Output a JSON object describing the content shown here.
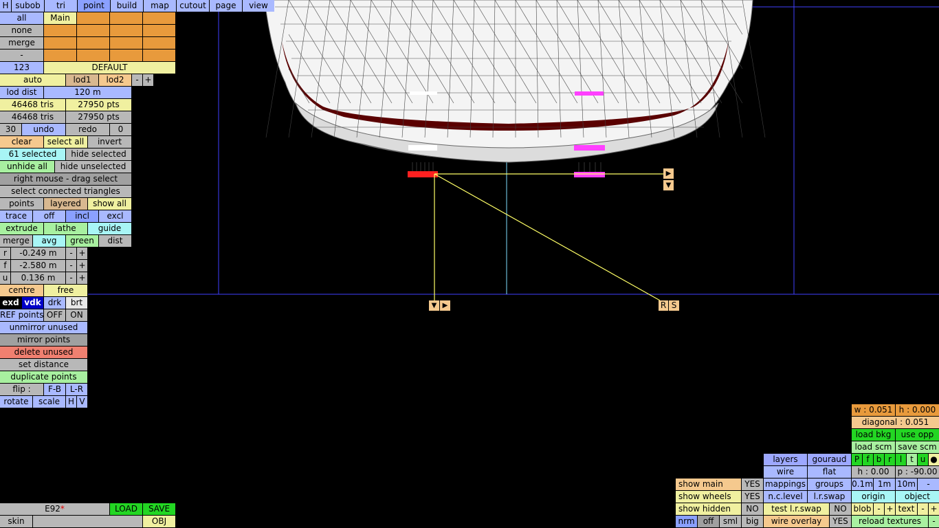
{
  "topbar": [
    "H",
    "subob",
    "tri",
    "point",
    "build",
    "map",
    "cutout",
    "page",
    "view"
  ],
  "sel_rows": {
    "all": "all",
    "main": "Main",
    "none": "none",
    "merge": "merge",
    "dash": "-",
    "num": "123",
    "default": "DEFAULT"
  },
  "lod": {
    "auto": "auto",
    "lod1": "lod1",
    "lod2": "lod2",
    "minus": "-",
    "plus": "+",
    "dist_label": "lod dist",
    "dist_value": "120 m"
  },
  "stats": {
    "tris1": "46468 tris",
    "pts1": "27950 pts",
    "tris2": "46468 tris",
    "pts2": "27950 pts"
  },
  "undo": {
    "count": "30",
    "undo": "undo",
    "redo": "redo",
    "zero": "0"
  },
  "select": {
    "clear": "clear",
    "select_all": "select all",
    "invert": "invert",
    "selected": "61 selected",
    "hide_selected": "hide selected",
    "unhide_all": "unhide all",
    "hide_unselected": "hide unselected",
    "drag_select": "right mouse - drag select",
    "connected": "select connected triangles"
  },
  "view_opts": {
    "points": "points",
    "layered": "layered",
    "show_all": "show all",
    "trace": "trace",
    "off": "off",
    "incl": "incl",
    "excl": "excl",
    "extrude": "extrude",
    "lathe": "lathe",
    "guide": "guide",
    "merge": "merge",
    "avg": "avg",
    "green": "green",
    "dist": "dist"
  },
  "coords": [
    {
      "axis": "r",
      "value": "-0.249 m"
    },
    {
      "axis": "f",
      "value": "-2.580 m"
    },
    {
      "axis": "u",
      "value": "0.136 m"
    }
  ],
  "steps": {
    "minus": "-",
    "plus": "+"
  },
  "centre": "centre",
  "free": "free",
  "brightness": {
    "exd": "exd",
    "vdk": "vdk",
    "drk": "drk",
    "brt": "brt"
  },
  "ref": {
    "label": "REF points",
    "off": "OFF",
    "on": "ON"
  },
  "actions": {
    "unmirror": "unmirror unused",
    "mirror": "mirror points",
    "delete": "delete unused",
    "set_distance": "set distance",
    "duplicate": "duplicate points",
    "flip": "flip :",
    "fb": "F-B",
    "lr": "L-R",
    "rotate": "rotate",
    "scale": "scale",
    "h": "H",
    "v": "V"
  },
  "file": {
    "name": "E92",
    "modified": "*",
    "load": "LOAD",
    "save": "SAVE",
    "skin": "skin",
    "obj": "OBJ"
  },
  "gizmo": {
    "arrow_right": "▶",
    "arrow_down": "▼",
    "r": "R",
    "s": "S"
  },
  "bottom_left_toggles": [
    {
      "label": "show main",
      "value": "YES"
    },
    {
      "label": "show wheels",
      "value": "YES"
    },
    {
      "label": "show hidden",
      "value": "NO"
    }
  ],
  "render": {
    "nrm": "nrm",
    "off": "off",
    "sml": "sml",
    "big": "big"
  },
  "middle_panel": {
    "layers": "layers",
    "gouraud": "gouraud",
    "wire": "wire",
    "flat": "flat",
    "mappings": "mappings",
    "groups": "groups",
    "nc_level": "n.c.level",
    "lr_swap": "l.r.swap",
    "test_lr_swap": "test l.r.swap",
    "test_value": "NO",
    "wire_overlay": "wire overlay",
    "wire_value": "YES"
  },
  "right_panel": {
    "w": "w : 0.051",
    "h": "h : 0.000",
    "diagonal": "diagonal : 0.051",
    "load_bkg": "load bkg",
    "use_opp": "use opp",
    "load_scm": "load scm",
    "save_scm": "save scm",
    "views": [
      "P",
      "f",
      "b",
      "r",
      "l",
      "t",
      "u",
      "●"
    ],
    "h_angle": "h : 0.00",
    "p_angle": "p : -90.00",
    "grid": [
      "0.1m",
      "1m",
      "10m",
      "-"
    ],
    "origin": "origin",
    "object": "object",
    "blob": "blob",
    "text": "text",
    "reload": "reload textures"
  },
  "colors": {
    "wire": "#ffffff",
    "guide_line": "#ffff66",
    "frame": "#4040ff",
    "sel_red": "#ff2020",
    "sel_magenta": "#ff40ff"
  }
}
